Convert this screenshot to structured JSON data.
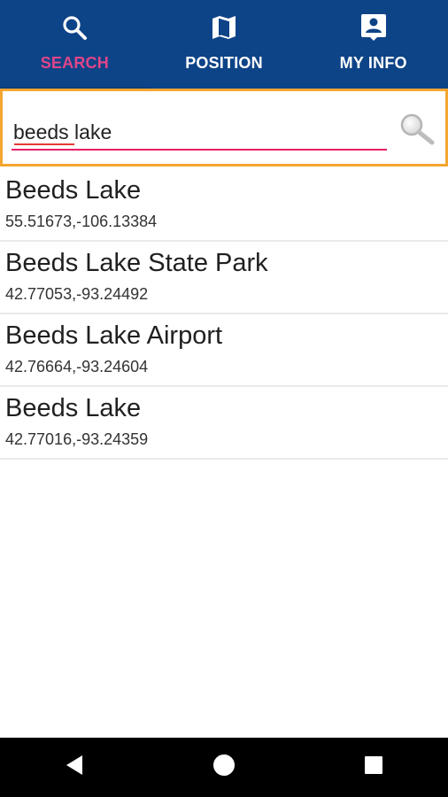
{
  "tabs": [
    {
      "label": "SEARCH",
      "icon": "search-icon",
      "active": true
    },
    {
      "label": "POSITION",
      "icon": "map-icon",
      "active": false
    },
    {
      "label": "MY INFO",
      "icon": "contact-card-icon",
      "active": false
    }
  ],
  "search": {
    "value": "beeds lake",
    "button_icon": "magnifier-icon"
  },
  "results": [
    {
      "name": "Beeds Lake",
      "coords": "55.51673,-106.13384"
    },
    {
      "name": "Beeds Lake State Park",
      "coords": "42.77053,-93.24492"
    },
    {
      "name": "Beeds Lake Airport",
      "coords": "42.76664,-93.24604"
    },
    {
      "name": "Beeds Lake",
      "coords": "42.77016,-93.24359"
    }
  ],
  "nav": {
    "back_icon": "back-triangle-icon",
    "home_icon": "home-circle-icon",
    "recents_icon": "recents-square-icon"
  },
  "colors": {
    "header_bg": "#0d4387",
    "active_tab": "#e0458a",
    "search_border": "#f6a531",
    "input_underline": "#e91e63"
  }
}
